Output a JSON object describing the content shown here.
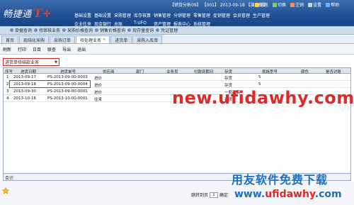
{
  "app": {
    "logo_text": "畅捷通",
    "logo_mark": "T+"
  },
  "topbar": {
    "user_info": "【销货分析09】 【001】 2013-09-18 【演示版】",
    "actions": [
      {
        "label": "消息",
        "icon": "message-icon"
      },
      {
        "label": "切换",
        "icon": "switch-icon"
      },
      {
        "label": "注销",
        "icon": "logout-icon"
      },
      {
        "label": "设置",
        "icon": "gear-icon"
      },
      {
        "label": "帮助",
        "icon": "help-icon"
      }
    ],
    "menu_row1": [
      "基础设置",
      "基础设置",
      "采购管理",
      "库存核算",
      "销售管理",
      "分销管理",
      "零售管理",
      "促销管理",
      "会员管理",
      "生产管理"
    ],
    "menu_row2": [
      "企业往来",
      "现金银行",
      "总账",
      "T-UFO",
      "资产管理",
      "报表中心",
      "系统管理"
    ]
  },
  "nav": [
    "单据查询",
    "待审核业务",
    "采购价格查询",
    "销售价格查询",
    "现存量查询",
    "凭证管理"
  ],
  "tabs": [
    {
      "label": "首页",
      "closable": false
    },
    {
      "label": "现结化采购",
      "closable": false
    },
    {
      "label": "采购订单",
      "closable": false
    },
    {
      "label": "待处理业务",
      "closable": true,
      "active": true
    },
    {
      "label": "进货单",
      "closable": false
    },
    {
      "label": "采购入库单",
      "closable": false
    }
  ],
  "toolbar": [
    "刷新",
    "打印",
    "日目",
    "联查",
    "导出",
    "退出"
  ],
  "filter": {
    "value": "进货单待结款业务"
  },
  "grid": {
    "headers": [
      "序号",
      "进货日期",
      "进货单号",
      "供应商",
      "部门",
      "业务员",
      "付款到期日",
      "存货",
      "规格型号",
      "颜色",
      "是否对账"
    ],
    "rows": [
      [
        "1",
        "2013-09-17",
        "PS-2013-09-00-0003",
        "进价",
        "",
        "",
        "",
        "存货",
        "5",
        "",
        ""
      ],
      [
        "2",
        "2013-09-18",
        "PS-2013-09-00-0004",
        "进价",
        "",
        "",
        "",
        "存货",
        "5",
        "",
        ""
      ],
      [
        "3",
        "2013-09-30",
        "PS-2013-09-00-0001",
        "进价",
        "",
        "",
        "",
        "一般商品",
        "",
        "",
        ""
      ],
      [
        "4",
        "2013-10-16",
        "PS-2013-10-00-0001",
        "往来",
        "",
        "",
        "",
        "存货",
        "",
        "",
        ""
      ]
    ]
  },
  "watermark": "new.ufidawhy.com",
  "summary": {
    "label": "合计"
  },
  "pager": {
    "label": "跳转到页",
    "page": "1",
    "go": "确定"
  },
  "brand": {
    "line1": "用友软件免费下载",
    "line2_a": "www.",
    "line2_b": "ufidawhy",
    "line2_c": ".com"
  },
  "colors": {
    "topbar": "#1f4f92",
    "highlight": "#d0202a",
    "watermark": "#e32626",
    "brand": "#1e6fc2"
  }
}
